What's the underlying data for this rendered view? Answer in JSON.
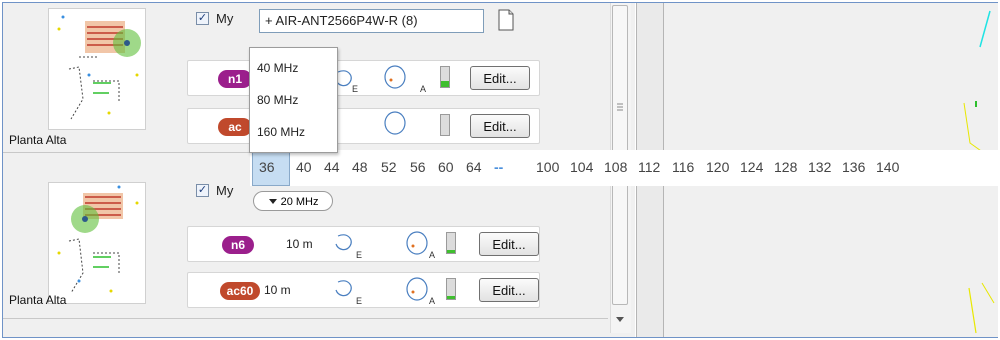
{
  "header": {
    "my_label": "My",
    "antenna_combo_value": "+ AIR-ANT2566P4W-R (8)"
  },
  "floors": [
    {
      "floor_label": "Planta Alta",
      "my_label": "My",
      "bands": [
        {
          "badge": "n1",
          "radius": "",
          "edit_label": "Edit...",
          "level": 0.3
        },
        {
          "badge": "ac",
          "radius": "",
          "edit_label": "Edit...",
          "level": 0
        }
      ]
    },
    {
      "floor_label": "Planta Alta",
      "my_label": "My",
      "bands": [
        {
          "badge": "n6",
          "radius": "10 m",
          "edit_label": "Edit...",
          "level": 0.15
        },
        {
          "badge": "ac60",
          "radius": "10 m",
          "edit_label": "Edit...",
          "level": 0.15
        }
      ]
    }
  ],
  "antenna_labels": {
    "e": "E",
    "a": "A"
  },
  "channel_width_menu": [
    "40 MHz",
    "80 MHz",
    "160 MHz"
  ],
  "channel_width_selected": "20 MHz",
  "channels": [
    "36",
    "40",
    "44",
    "48",
    "52",
    "56",
    "60",
    "64",
    "--",
    "100",
    "104",
    "108",
    "112",
    "116",
    "120",
    "124",
    "128",
    "132",
    "136",
    "140"
  ],
  "selected_channel": "36",
  "colors": {
    "band_n": "#9b1f8c",
    "band_ac": "#c0492c",
    "meter_green": "#3fbf2f",
    "selection": "#c6ddf2"
  },
  "icons": [
    "document-icon",
    "coverage-pattern-icon",
    "dropdown-arrow-icon",
    "scroll-grip-icon"
  ]
}
